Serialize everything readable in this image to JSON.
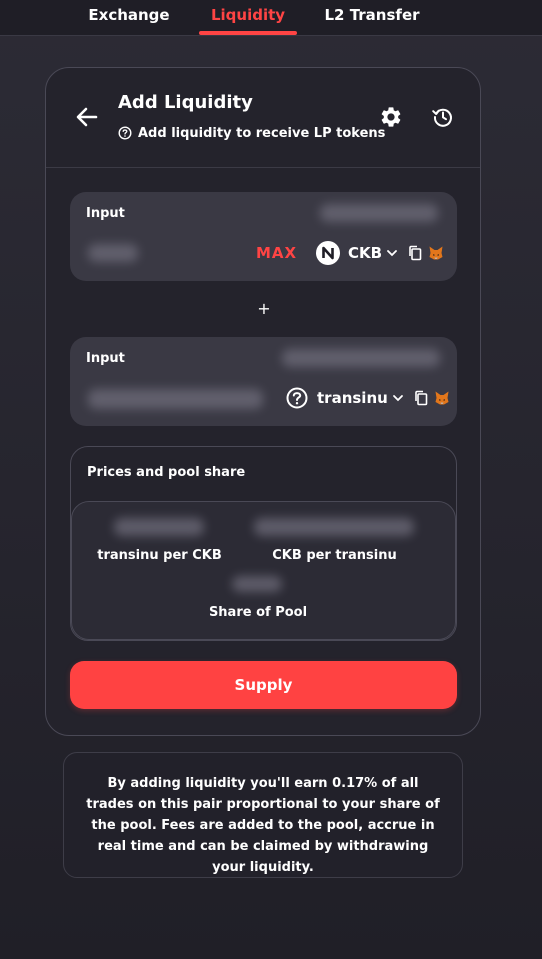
{
  "nav": {
    "tabs": [
      {
        "label": "Exchange"
      },
      {
        "label": "Liquidity"
      },
      {
        "label": "L2 Transfer"
      }
    ],
    "active_tab": "Liquidity"
  },
  "card": {
    "title": "Add Liquidity",
    "subtitle": "Add liquidity to receive LP tokens",
    "icons": [
      "back-arrow-icon",
      "gear-icon",
      "history-icon"
    ]
  },
  "input_a": {
    "label": "Input",
    "max_label": "MAX",
    "token_symbol": "CKB",
    "token_icon": "ckb-logo"
  },
  "plus": "+",
  "input_b": {
    "label": "Input",
    "token_symbol": "transinu",
    "token_icon": "unknown-token-icon"
  },
  "prices": {
    "title": "Prices and pool share",
    "items": [
      {
        "label": "transinu per CKB"
      },
      {
        "label": "CKB per transinu"
      },
      {
        "label": "Share of Pool"
      }
    ]
  },
  "supply_button": "Supply",
  "info_text": "By adding liquidity you'll earn 0.17% of all trades on this pair proportional to your share of the pool. Fees are added to the pool, accrue in real time and can be claimed by withdrawing your liquidity.",
  "colors": {
    "accent": "#ff4444",
    "background": "#2c2b35",
    "card": "#24232c",
    "input": "#3a3944"
  }
}
